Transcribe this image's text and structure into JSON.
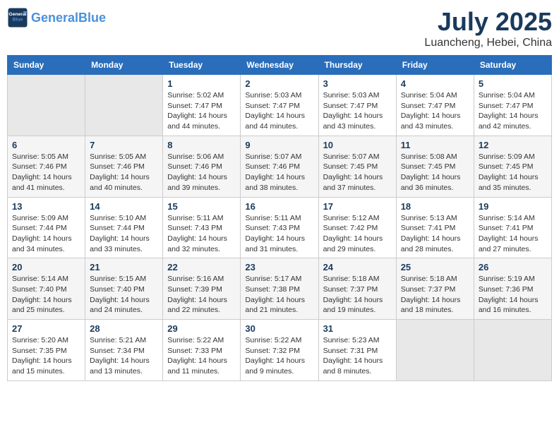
{
  "header": {
    "logo_general": "General",
    "logo_blue": "Blue",
    "month_title": "July 2025",
    "subtitle": "Luancheng, Hebei, China"
  },
  "weekdays": [
    "Sunday",
    "Monday",
    "Tuesday",
    "Wednesday",
    "Thursday",
    "Friday",
    "Saturday"
  ],
  "weeks": [
    [
      {
        "day": "",
        "empty": true
      },
      {
        "day": "",
        "empty": true
      },
      {
        "day": "1",
        "sunrise": "Sunrise: 5:02 AM",
        "sunset": "Sunset: 7:47 PM",
        "daylight": "Daylight: 14 hours and 44 minutes."
      },
      {
        "day": "2",
        "sunrise": "Sunrise: 5:03 AM",
        "sunset": "Sunset: 7:47 PM",
        "daylight": "Daylight: 14 hours and 44 minutes."
      },
      {
        "day": "3",
        "sunrise": "Sunrise: 5:03 AM",
        "sunset": "Sunset: 7:47 PM",
        "daylight": "Daylight: 14 hours and 43 minutes."
      },
      {
        "day": "4",
        "sunrise": "Sunrise: 5:04 AM",
        "sunset": "Sunset: 7:47 PM",
        "daylight": "Daylight: 14 hours and 43 minutes."
      },
      {
        "day": "5",
        "sunrise": "Sunrise: 5:04 AM",
        "sunset": "Sunset: 7:47 PM",
        "daylight": "Daylight: 14 hours and 42 minutes."
      }
    ],
    [
      {
        "day": "6",
        "sunrise": "Sunrise: 5:05 AM",
        "sunset": "Sunset: 7:46 PM",
        "daylight": "Daylight: 14 hours and 41 minutes."
      },
      {
        "day": "7",
        "sunrise": "Sunrise: 5:05 AM",
        "sunset": "Sunset: 7:46 PM",
        "daylight": "Daylight: 14 hours and 40 minutes."
      },
      {
        "day": "8",
        "sunrise": "Sunrise: 5:06 AM",
        "sunset": "Sunset: 7:46 PM",
        "daylight": "Daylight: 14 hours and 39 minutes."
      },
      {
        "day": "9",
        "sunrise": "Sunrise: 5:07 AM",
        "sunset": "Sunset: 7:46 PM",
        "daylight": "Daylight: 14 hours and 38 minutes."
      },
      {
        "day": "10",
        "sunrise": "Sunrise: 5:07 AM",
        "sunset": "Sunset: 7:45 PM",
        "daylight": "Daylight: 14 hours and 37 minutes."
      },
      {
        "day": "11",
        "sunrise": "Sunrise: 5:08 AM",
        "sunset": "Sunset: 7:45 PM",
        "daylight": "Daylight: 14 hours and 36 minutes."
      },
      {
        "day": "12",
        "sunrise": "Sunrise: 5:09 AM",
        "sunset": "Sunset: 7:45 PM",
        "daylight": "Daylight: 14 hours and 35 minutes."
      }
    ],
    [
      {
        "day": "13",
        "sunrise": "Sunrise: 5:09 AM",
        "sunset": "Sunset: 7:44 PM",
        "daylight": "Daylight: 14 hours and 34 minutes."
      },
      {
        "day": "14",
        "sunrise": "Sunrise: 5:10 AM",
        "sunset": "Sunset: 7:44 PM",
        "daylight": "Daylight: 14 hours and 33 minutes."
      },
      {
        "day": "15",
        "sunrise": "Sunrise: 5:11 AM",
        "sunset": "Sunset: 7:43 PM",
        "daylight": "Daylight: 14 hours and 32 minutes."
      },
      {
        "day": "16",
        "sunrise": "Sunrise: 5:11 AM",
        "sunset": "Sunset: 7:43 PM",
        "daylight": "Daylight: 14 hours and 31 minutes."
      },
      {
        "day": "17",
        "sunrise": "Sunrise: 5:12 AM",
        "sunset": "Sunset: 7:42 PM",
        "daylight": "Daylight: 14 hours and 29 minutes."
      },
      {
        "day": "18",
        "sunrise": "Sunrise: 5:13 AM",
        "sunset": "Sunset: 7:41 PM",
        "daylight": "Daylight: 14 hours and 28 minutes."
      },
      {
        "day": "19",
        "sunrise": "Sunrise: 5:14 AM",
        "sunset": "Sunset: 7:41 PM",
        "daylight": "Daylight: 14 hours and 27 minutes."
      }
    ],
    [
      {
        "day": "20",
        "sunrise": "Sunrise: 5:14 AM",
        "sunset": "Sunset: 7:40 PM",
        "daylight": "Daylight: 14 hours and 25 minutes."
      },
      {
        "day": "21",
        "sunrise": "Sunrise: 5:15 AM",
        "sunset": "Sunset: 7:40 PM",
        "daylight": "Daylight: 14 hours and 24 minutes."
      },
      {
        "day": "22",
        "sunrise": "Sunrise: 5:16 AM",
        "sunset": "Sunset: 7:39 PM",
        "daylight": "Daylight: 14 hours and 22 minutes."
      },
      {
        "day": "23",
        "sunrise": "Sunrise: 5:17 AM",
        "sunset": "Sunset: 7:38 PM",
        "daylight": "Daylight: 14 hours and 21 minutes."
      },
      {
        "day": "24",
        "sunrise": "Sunrise: 5:18 AM",
        "sunset": "Sunset: 7:37 PM",
        "daylight": "Daylight: 14 hours and 19 minutes."
      },
      {
        "day": "25",
        "sunrise": "Sunrise: 5:18 AM",
        "sunset": "Sunset: 7:37 PM",
        "daylight": "Daylight: 14 hours and 18 minutes."
      },
      {
        "day": "26",
        "sunrise": "Sunrise: 5:19 AM",
        "sunset": "Sunset: 7:36 PM",
        "daylight": "Daylight: 14 hours and 16 minutes."
      }
    ],
    [
      {
        "day": "27",
        "sunrise": "Sunrise: 5:20 AM",
        "sunset": "Sunset: 7:35 PM",
        "daylight": "Daylight: 14 hours and 15 minutes."
      },
      {
        "day": "28",
        "sunrise": "Sunrise: 5:21 AM",
        "sunset": "Sunset: 7:34 PM",
        "daylight": "Daylight: 14 hours and 13 minutes."
      },
      {
        "day": "29",
        "sunrise": "Sunrise: 5:22 AM",
        "sunset": "Sunset: 7:33 PM",
        "daylight": "Daylight: 14 hours and 11 minutes."
      },
      {
        "day": "30",
        "sunrise": "Sunrise: 5:22 AM",
        "sunset": "Sunset: 7:32 PM",
        "daylight": "Daylight: 14 hours and 9 minutes."
      },
      {
        "day": "31",
        "sunrise": "Sunrise: 5:23 AM",
        "sunset": "Sunset: 7:31 PM",
        "daylight": "Daylight: 14 hours and 8 minutes."
      },
      {
        "day": "",
        "empty": true
      },
      {
        "day": "",
        "empty": true
      }
    ]
  ]
}
